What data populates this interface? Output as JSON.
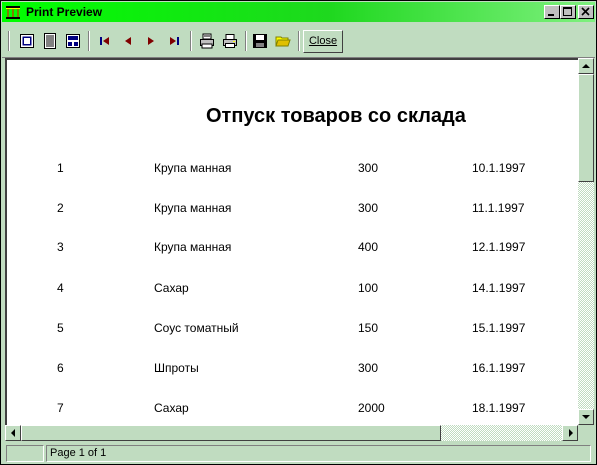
{
  "window": {
    "title": "Print Preview",
    "minimize_icon": "minimize-icon",
    "maximize_icon": "maximize-icon",
    "close_icon": "close-icon"
  },
  "toolbar": {
    "buttons": [
      {
        "name": "fit-page-button",
        "icon": "fit-page-icon"
      },
      {
        "name": "fit-width-button",
        "icon": "fit-width-icon"
      },
      {
        "name": "zoom-button",
        "icon": "zoom-icon"
      },
      {
        "name": "first-page-button",
        "icon": "first-page-icon"
      },
      {
        "name": "prev-page-button",
        "icon": "prev-page-icon"
      },
      {
        "name": "next-page-button",
        "icon": "next-page-icon"
      },
      {
        "name": "last-page-button",
        "icon": "last-page-icon"
      },
      {
        "name": "print-setup-button",
        "icon": "printer-setup-icon"
      },
      {
        "name": "print-button",
        "icon": "printer-icon"
      },
      {
        "name": "save-button",
        "icon": "floppy-disk-icon"
      },
      {
        "name": "open-button",
        "icon": "open-folder-icon"
      }
    ],
    "close_label": "Close"
  },
  "report": {
    "title": "Отпуск товаров со склада",
    "rows": [
      {
        "n": "1",
        "item": "Крупа манная",
        "qty": "300",
        "date": "10.1.1997"
      },
      {
        "n": "2",
        "item": "Крупа манная",
        "qty": "300",
        "date": "11.1.1997"
      },
      {
        "n": "3",
        "item": "Крупа манная",
        "qty": "400",
        "date": "12.1.1997"
      },
      {
        "n": "4",
        "item": "Сахар",
        "qty": "100",
        "date": "14.1.1997"
      },
      {
        "n": "5",
        "item": "Соус томатный",
        "qty": "150",
        "date": "15.1.1997"
      },
      {
        "n": "6",
        "item": "Шпроты",
        "qty": "300",
        "date": "16.1.1997"
      },
      {
        "n": "7",
        "item": "Сахар",
        "qty": "2000",
        "date": "18.1.1997"
      }
    ]
  },
  "status": {
    "page": "Page 1 of 1"
  },
  "colors": {
    "title_gradient_start": "#00ff00",
    "window_face": "#c0dcc0",
    "accent_blue": "#000080",
    "accent_red": "#800000"
  }
}
